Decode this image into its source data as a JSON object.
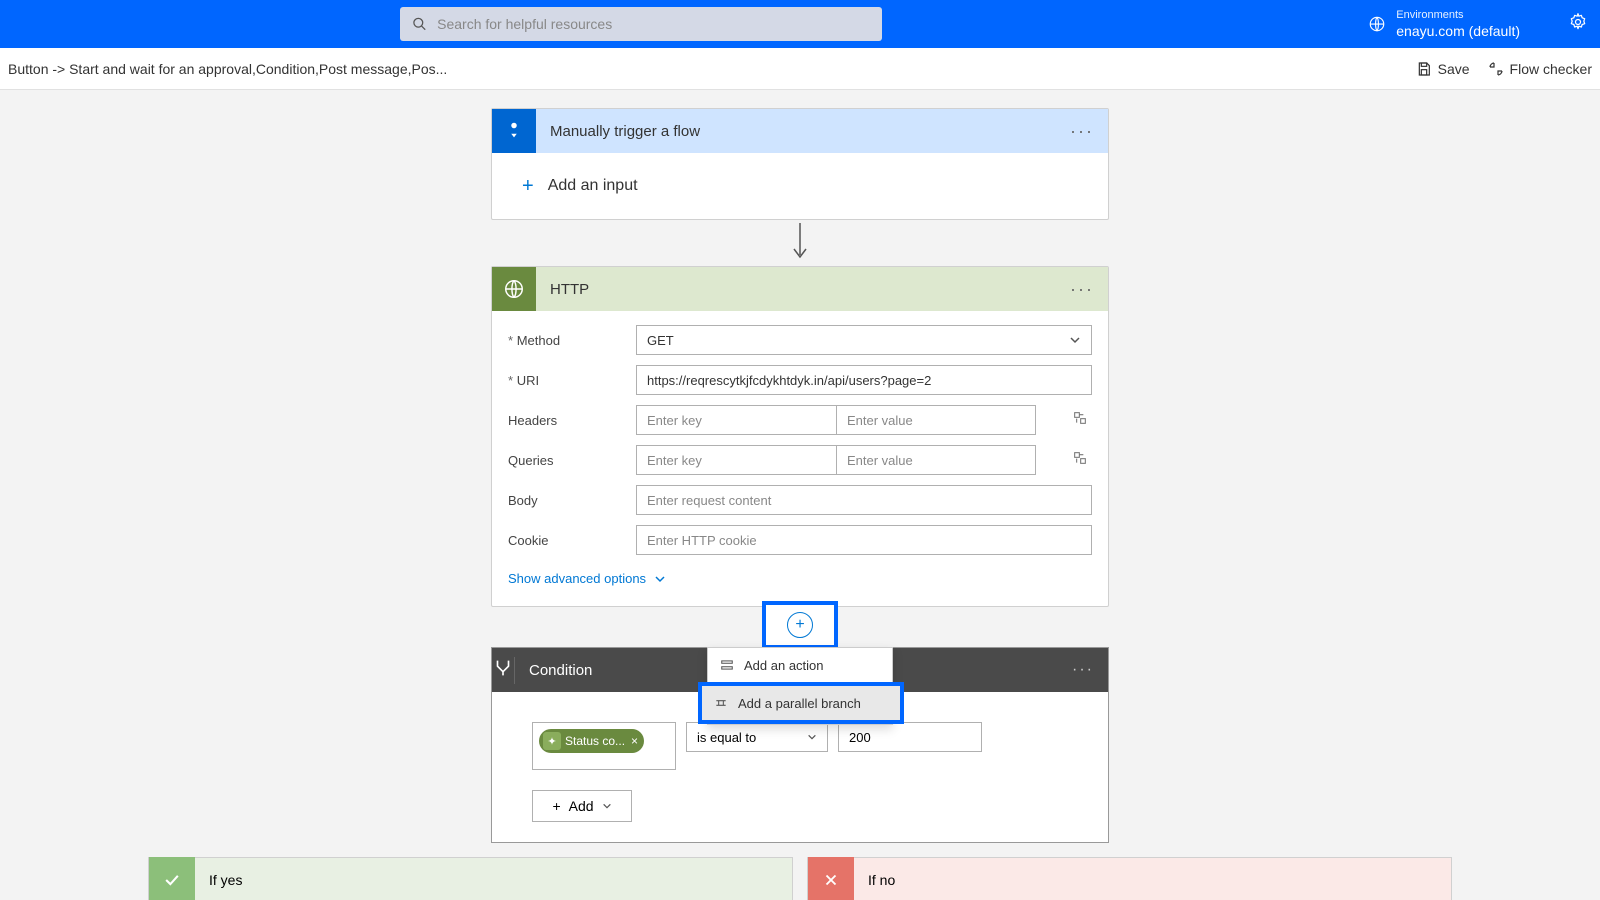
{
  "header": {
    "search_placeholder": "Search for helpful resources",
    "env_label": "Environments",
    "env_name": "enayu.com (default)"
  },
  "toolbar": {
    "breadcrumb": "Button -> Start and wait for an approval,Condition,Post message,Pos...",
    "save": "Save",
    "flow_checker": "Flow checker"
  },
  "trigger": {
    "title": "Manually trigger a flow",
    "add_input": "Add an input"
  },
  "http": {
    "title": "HTTP",
    "labels": {
      "method": "Method",
      "uri": "URI",
      "headers": "Headers",
      "queries": "Queries",
      "body": "Body",
      "cookie": "Cookie"
    },
    "method_value": "GET",
    "uri_value": "https://reqrescytkjfcdykhtdyk.in/api/users?page=2",
    "placeholders": {
      "key": "Enter key",
      "value": "Enter value",
      "body": "Enter request content",
      "cookie": "Enter HTTP cookie"
    },
    "show_advanced": "Show advanced options"
  },
  "insert_menu": {
    "add_action": "Add an action",
    "add_parallel": "Add a parallel branch"
  },
  "condition": {
    "title": "Condition",
    "pill": "Status co...",
    "operator": "is equal to",
    "value": "200",
    "add": "Add"
  },
  "branches": {
    "yes": "If yes",
    "no": "If no"
  }
}
